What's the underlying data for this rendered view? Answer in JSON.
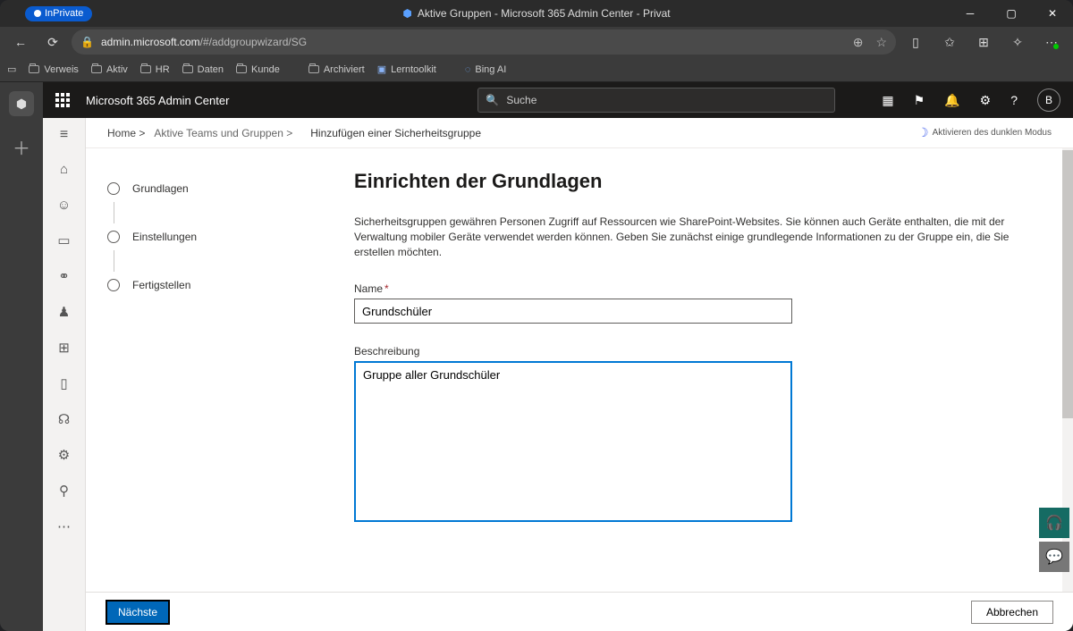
{
  "browser": {
    "inprivate_label": "InPrivate",
    "tab_title": "Aktive Gruppen - Microsoft 365 Admin Center - Privat",
    "url_host": "admin.microsoft.com",
    "url_path": "/#/addgroupwizard/SG"
  },
  "favorites": {
    "items": [
      "Verweis",
      "Aktiv",
      "HR",
      "Daten",
      "Kunde",
      "Archiviert",
      "Lerntoolkit",
      "Bing AI"
    ]
  },
  "m365": {
    "brand": "Microsoft 365 Admin Center",
    "search_placeholder": "Suche",
    "avatar_initial": "B"
  },
  "breadcrumbs": {
    "home": "Home >",
    "level2": "Aktive Teams und Gruppen >",
    "current": "Hinzufügen einer Sicherheitsgruppe",
    "dark_mode": "Aktivieren des dunklen Modus"
  },
  "wizard": {
    "steps": [
      "Grundlagen",
      "Einstellungen",
      "Fertigstellen"
    ],
    "heading": "Einrichten der Grundlagen",
    "description": "Sicherheitsgruppen gewähren Personen Zugriff auf Ressourcen wie SharePoint-Websites. Sie können auch Geräte enthalten, die mit der Verwaltung mobiler Geräte verwendet werden können. Geben Sie zunächst einige grundlegende Informationen zu der Gruppe ein, die Sie erstellen möchten.",
    "name_label": "Name",
    "name_value": "Grundschüler",
    "desc_label": "Beschreibung",
    "desc_value": "Gruppe aller Grundschüler",
    "next_label": "Nächste",
    "cancel_label": "Abbrechen"
  }
}
